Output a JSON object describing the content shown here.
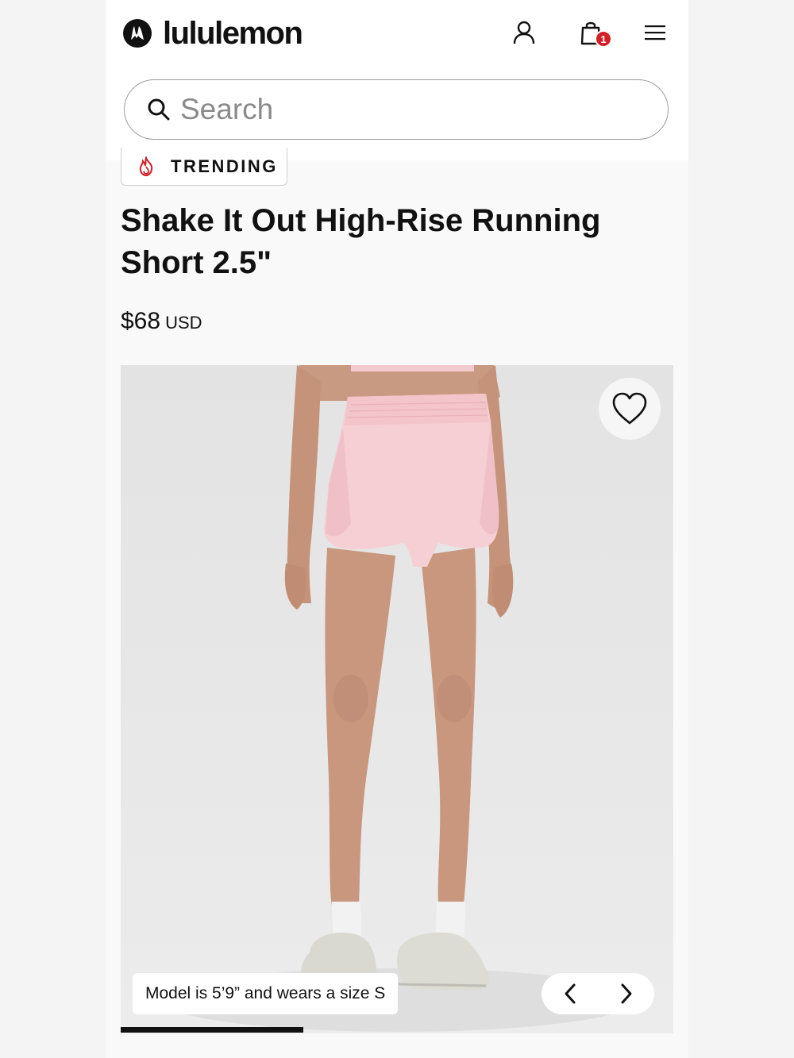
{
  "header": {
    "brand": "lululemon",
    "cart_count": "1"
  },
  "search": {
    "placeholder": "Search"
  },
  "product": {
    "badge": "TRENDING",
    "title": "Shake It Out High-Rise Running Short 2.5\"",
    "price": "$68",
    "currency": "USD"
  },
  "gallery": {
    "caption": "Model is 5’9” and wears a size S",
    "progress": 0.33
  },
  "colors": {
    "accent": "#d31f26",
    "text": "#111111",
    "short_color": "#f6cfd4"
  },
  "icons": {
    "account": "person-icon",
    "cart": "shopping-bag-icon",
    "menu": "hamburger-menu-icon",
    "search": "search-icon",
    "wishlist": "heart-icon",
    "prev": "chevron-left-icon",
    "next": "chevron-right-icon",
    "trending": "flame-icon"
  }
}
